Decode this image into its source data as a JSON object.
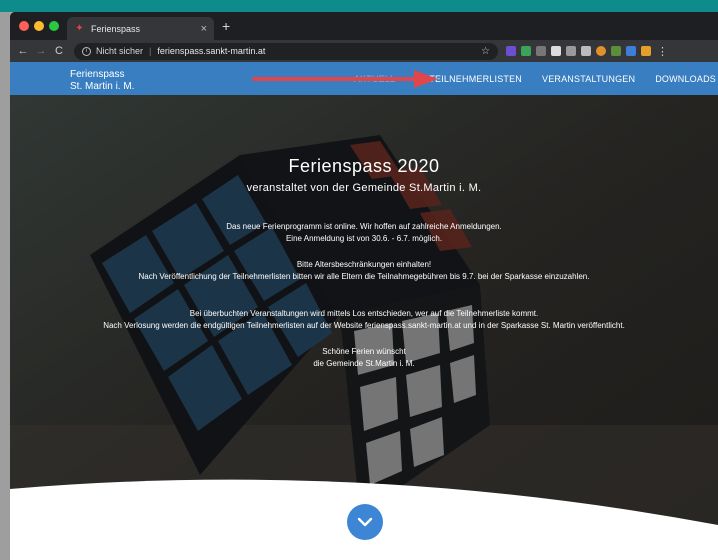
{
  "browser": {
    "tab_title": "Ferienspass",
    "tab_close": "×",
    "newtab": "+",
    "back": "←",
    "forward": "→",
    "reload": "C",
    "security_label": "Nicht sicher",
    "separator": "|",
    "url": "ferienspass.sankt-martin.at",
    "bookmark": "☆",
    "menu_dots": "⋮"
  },
  "site": {
    "brand_line1": "Ferienspass",
    "brand_line2": "St. Martin i. M.",
    "nav": [
      "AKTUELL",
      "TEILNEHMERLISTEN",
      "VERANSTALTUNGEN",
      "DOWNLOADS"
    ],
    "accent": "#3a7ec2",
    "arrow_color": "#e0474c"
  },
  "hero": {
    "title": "Ferienspass 2020",
    "subtitle": "veranstaltet von der Gemeinde St.Martin i. M.",
    "p1_l1": "Das neue Ferienprogramm ist online. Wir hoffen auf zahlreiche Anmeldungen.",
    "p1_l2": "Eine Anmeldung ist von 30.6. - 6.7. möglich.",
    "p2_l1": "Bitte Altersbeschränkungen einhalten!",
    "p2_l2": "Nach Veröffentlichung der Teilnehmerlisten bitten wir alle Eltern die Teilnahmegebühren bis 9.7. bei der Sparkasse einzuzahlen.",
    "p3_l1": "Bei überbuchten Veranstaltungen wird mittels Los entschieden, wer auf die Teilnehmerliste kommt.",
    "p3_l2": "Nach Verlosung werden die endgültigen Teilnehmerlisten auf der Website ferienspass.sankt-martin.at und in der Sparkasse St. Martin veröffentlicht.",
    "p4_l1": "Schöne Ferien wünscht",
    "p4_l2": "die Gemeinde St.Martin i. M."
  }
}
